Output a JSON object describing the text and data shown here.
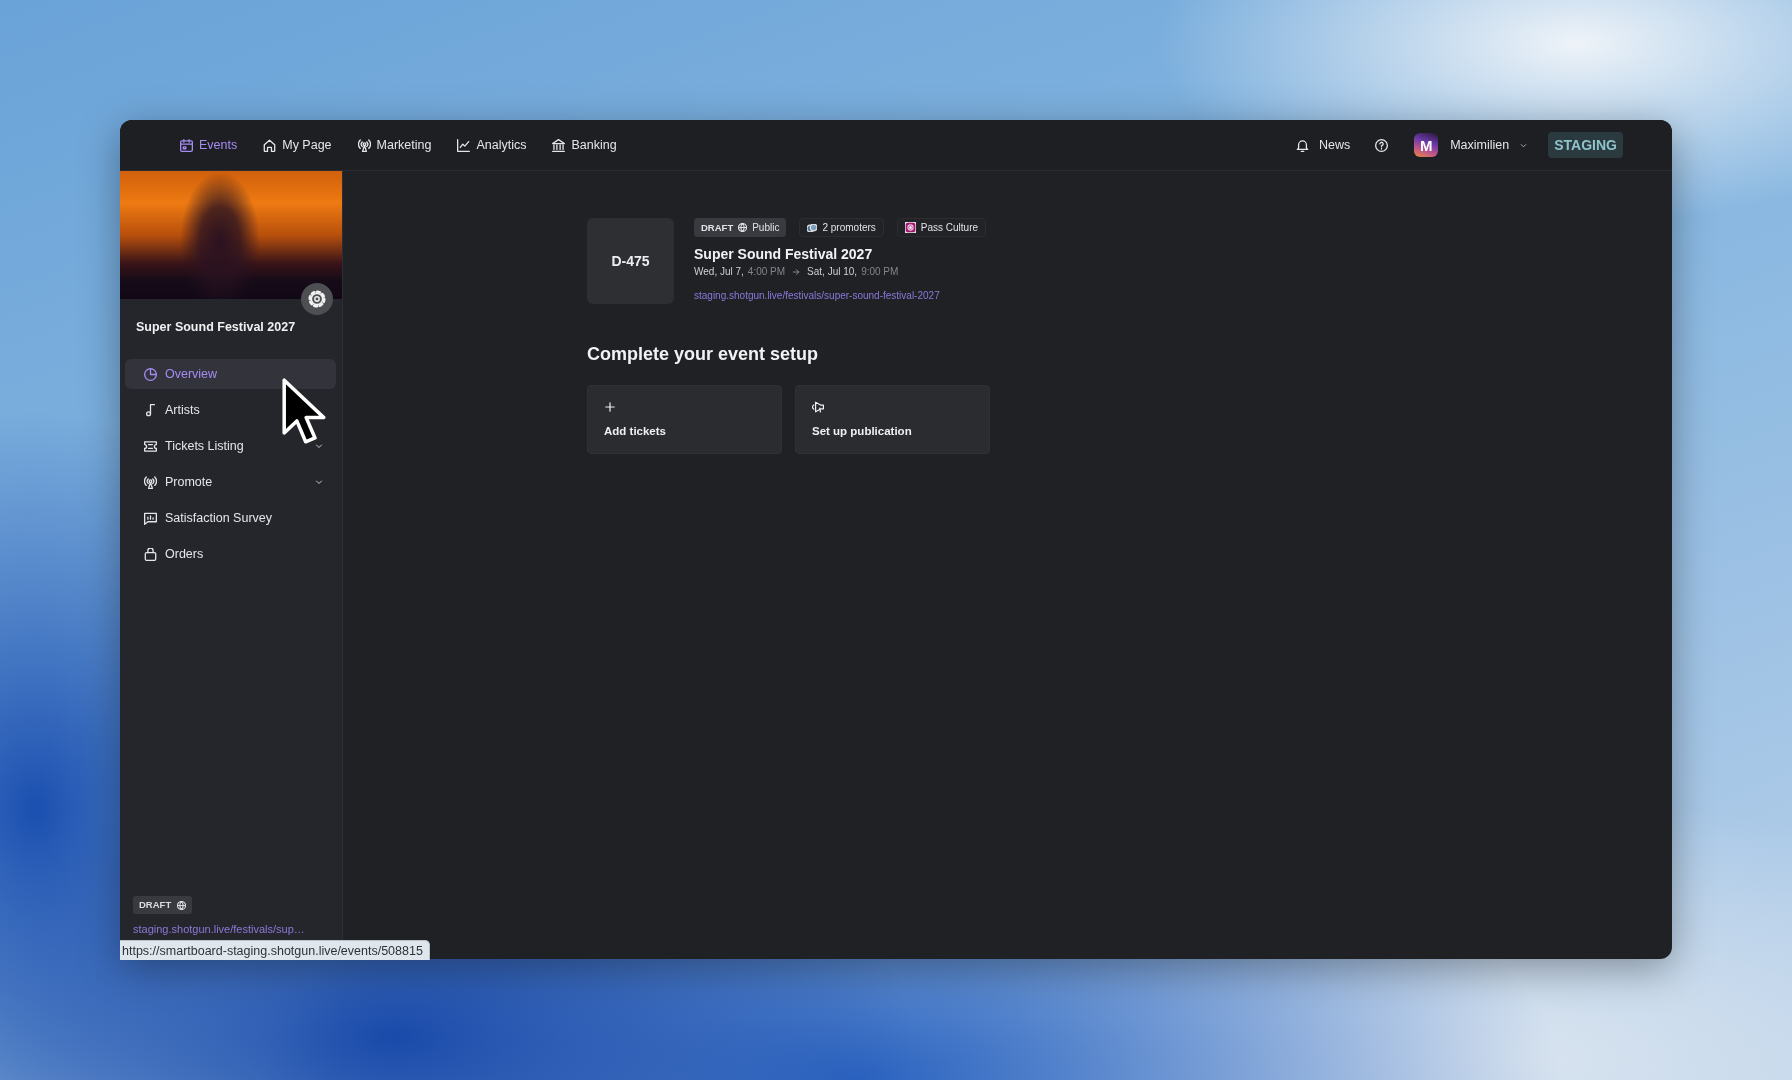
{
  "top_nav": {
    "items": [
      {
        "label": "Events",
        "selected": true
      },
      {
        "label": "My Page",
        "selected": false
      },
      {
        "label": "Marketing",
        "selected": false
      },
      {
        "label": "Analytics",
        "selected": false
      },
      {
        "label": "Banking",
        "selected": false
      }
    ],
    "news": "News",
    "user": {
      "avatar_letter": "M",
      "name": "Maximilien"
    },
    "environment": "STAGING"
  },
  "sidebar": {
    "event_name": "Super Sound Festival 2027",
    "items": [
      {
        "label": "Overview",
        "selected": true,
        "expandable": false
      },
      {
        "label": "Artists",
        "selected": false,
        "expandable": false
      },
      {
        "label": "Tickets Listing",
        "selected": false,
        "expandable": true
      },
      {
        "label": "Promote",
        "selected": false,
        "expandable": true
      },
      {
        "label": "Satisfaction Survey",
        "selected": false,
        "expandable": false
      },
      {
        "label": "Orders",
        "selected": false,
        "expandable": false
      }
    ],
    "footer": {
      "status": "DRAFT",
      "link": "staging.shotgun.live/festivals/sup…"
    }
  },
  "event": {
    "countdown": "D-475",
    "status": "DRAFT",
    "visibility": "Public",
    "promoters": "2 promoters",
    "partner": "Pass Culture",
    "title": "Super Sound Festival 2027",
    "start_day": "Wed, Jul 7,",
    "start_time": "4:00 PM",
    "end_day": "Sat, Jul 10,",
    "end_time": "9:00 PM",
    "url": "staging.shotgun.live/festivals/super-sound-festival-2027"
  },
  "setup": {
    "heading": "Complete your event setup",
    "cards": [
      {
        "label": "Add tickets"
      },
      {
        "label": "Set up publication"
      }
    ]
  },
  "link_preview": "https://smartboard-staging.shotgun.live/events/508815"
}
